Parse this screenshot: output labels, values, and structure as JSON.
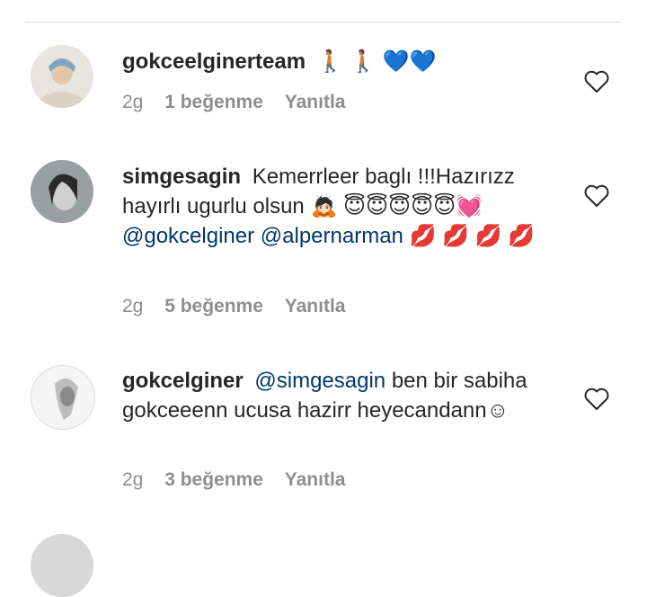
{
  "comments": [
    {
      "username": "gokceelginerteam",
      "text_parts": [
        {
          "type": "emoji",
          "value": "🚶🏽 🚶🏽 💙💙"
        }
      ],
      "time": "2g",
      "likes": "1 beğenme",
      "reply": "Yanıtla"
    },
    {
      "username": "simgesagin",
      "text_parts": [
        {
          "type": "text",
          "value": "Kemerrleer baglı !!!Hazırızz hayırlı ugurlu olsun"
        },
        {
          "type": "emoji",
          "value": "🙇🏻 😇😇😇😇😇💓"
        },
        {
          "type": "mention",
          "value": "@gokcelginer"
        },
        {
          "type": "mention",
          "value": "@alpernarman"
        },
        {
          "type": "emoji",
          "value": "💋 💋 💋 💋"
        }
      ],
      "time": "2g",
      "likes": "5 beğenme",
      "reply": "Yanıtla"
    },
    {
      "username": "gokcelginer",
      "text_parts": [
        {
          "type": "mention",
          "value": "@simgesagin"
        },
        {
          "type": "text",
          "value": "ben bir sabiha gokceeenn ucusa hazirr heyecandann"
        },
        {
          "type": "emoji",
          "value": "☺"
        }
      ],
      "time": "2g",
      "likes": "3 beğenme",
      "reply": "Yanıtla"
    }
  ]
}
